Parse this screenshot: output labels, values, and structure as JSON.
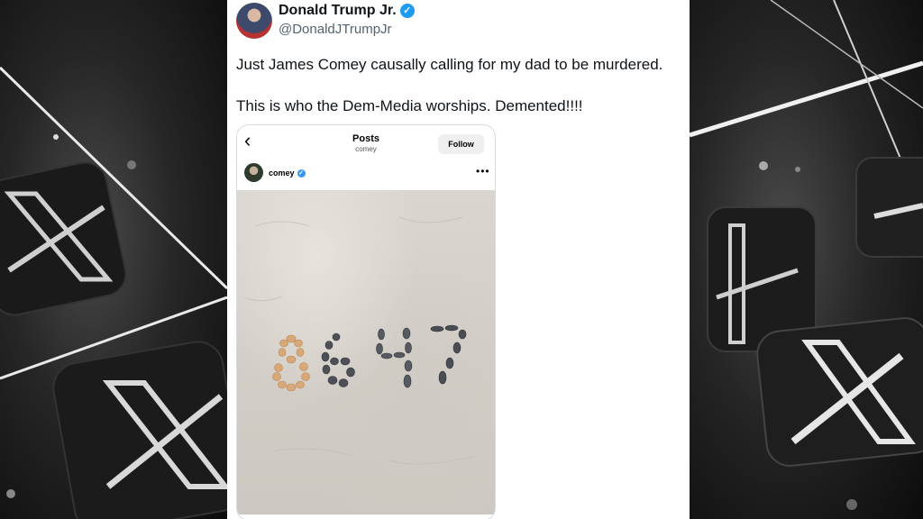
{
  "tweet": {
    "display_name": "Donald Trump Jr.",
    "handle": "@DonaldJTrumpJr",
    "verified_icon": "verified-badge-icon",
    "text_line1": "Just James Comey causally calling for my dad to be murdered.",
    "text_line2": "This is who the Dem-Media worships. Demented!!!!"
  },
  "embed": {
    "back_icon": "chevron-left-icon",
    "title": "Posts",
    "subtitle": "comey",
    "follow_label": "Follow",
    "username": "comey",
    "more_icon": "more-horizontal-icon",
    "photo_caption_in_sand": "8647"
  },
  "colors": {
    "verified_blue": "#1d9bf0",
    "text_primary": "#0f1419",
    "text_secondary": "#536471"
  }
}
